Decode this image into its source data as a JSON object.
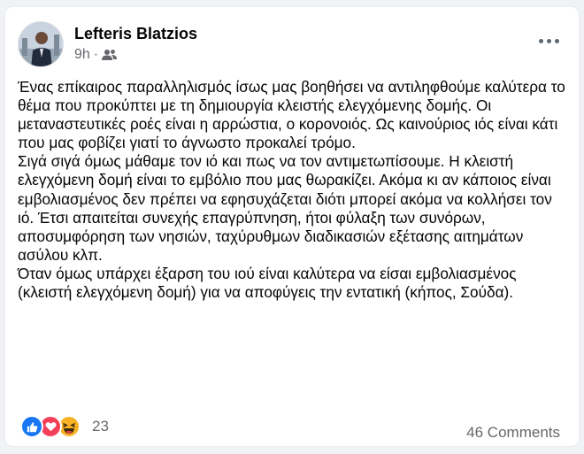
{
  "post": {
    "author": "Lefteris Blatzios",
    "time": "9h",
    "audience_icon": "friends-icon",
    "more_icon": "more-horizontal-icon",
    "paragraphs": [
      "Ένας επίκαιρος παραλληλισμός ίσως μας βοηθήσει να αντιληφθούμε καλύτερα το θέμα που προκύπτει με τη δημιουργία κλειστής ελεγχόμενης δομής. Οι μεταναστευτικές ροές είναι η αρρώστια, ο κορονοιός. Ως καινούριος ιός είναι κάτι που μας φοβίζει γιατί το άγνωστο προκαλεί τρόμο.",
      "Σιγά σιγά όμως μάθαμε τον ιό και πως να τον αντιμετωπίσουμε. Η κλειστή ελεγχόμενη δομή είναι το εμβόλιο που μας θωρακίζει. Ακόμα κι αν κάποιος είναι εμβολιασμένος δεν πρέπει να εφησυχάζεται διότι μπορεί ακόμα να κολλήσει τον ιό. Έτσι απαιτείται συνεχής επαγρύπνηση,  ήτοι φύλαξη των συνόρων,  αποσυμφόρηση των νησιών, ταχύρυθμων διαδικασιών εξέτασης αιτημάτων ασύλου κλπ.",
      "Όταν όμως υπάρχει έξαρση του ιού είναι καλύτερα να είσαι εμβολιασμένος (κλειστή ελεγχόμενη δομή) για να αποφύγεις την εντατική (κήπος, Σούδα)."
    ]
  },
  "footer": {
    "reaction_icons": [
      "like-icon",
      "love-icon",
      "haha-icon"
    ],
    "reaction_count": "23",
    "comments": "46 Comments"
  },
  "colors": {
    "like": "#1877f2",
    "love": "#f33e58",
    "haha": "#f7b125",
    "text": "#050505",
    "secondary_text": "#65676b",
    "background": "#f0f2f5"
  }
}
